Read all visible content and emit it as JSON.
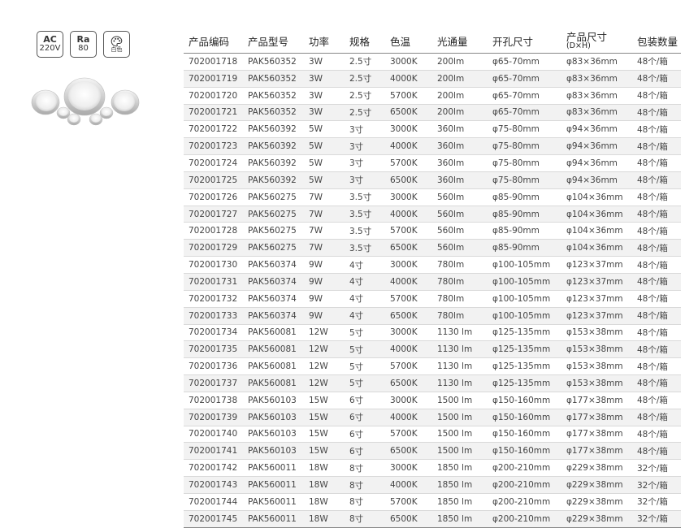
{
  "badges": [
    {
      "top": "AC",
      "bottom": "220V"
    },
    {
      "top": "Ra",
      "bottom": "80"
    },
    {
      "top_icon": "palette-icon",
      "bottom": "白色"
    }
  ],
  "table": {
    "headers": [
      "产品编码",
      "产品型号",
      "功率",
      "规格",
      "色温",
      "光通量",
      "开孔尺寸",
      "产品尺寸",
      "包装数量"
    ],
    "header_sub": "(D×H)",
    "rows": [
      [
        "702001718",
        "PAK560352",
        "3W",
        "2.5寸",
        "3000K",
        "200lm",
        "φ65-70mm",
        "φ83×36mm",
        "48个/箱"
      ],
      [
        "702001719",
        "PAK560352",
        "3W",
        "2.5寸",
        "4000K",
        "200lm",
        "φ65-70mm",
        "φ83×36mm",
        "48个/箱"
      ],
      [
        "702001720",
        "PAK560352",
        "3W",
        "2.5寸",
        "5700K",
        "200lm",
        "φ65-70mm",
        "φ83×36mm",
        "48个/箱"
      ],
      [
        "702001721",
        "PAK560352",
        "3W",
        "2.5寸",
        "6500K",
        "200lm",
        "φ65-70mm",
        "φ83×36mm",
        "48个/箱"
      ],
      [
        "702001722",
        "PAK560392",
        "5W",
        "3寸",
        "3000K",
        "360lm",
        "φ75-80mm",
        "φ94×36mm",
        "48个/箱"
      ],
      [
        "702001723",
        "PAK560392",
        "5W",
        "3寸",
        "4000K",
        "360lm",
        "φ75-80mm",
        "φ94×36mm",
        "48个/箱"
      ],
      [
        "702001724",
        "PAK560392",
        "5W",
        "3寸",
        "5700K",
        "360lm",
        "φ75-80mm",
        "φ94×36mm",
        "48个/箱"
      ],
      [
        "702001725",
        "PAK560392",
        "5W",
        "3寸",
        "6500K",
        "360lm",
        "φ75-80mm",
        "φ94×36mm",
        "48个/箱"
      ],
      [
        "702001726",
        "PAK560275",
        "7W",
        "3.5寸",
        "3000K",
        "560lm",
        "φ85-90mm",
        "φ104×36mm",
        "48个/箱"
      ],
      [
        "702001727",
        "PAK560275",
        "7W",
        "3.5寸",
        "4000K",
        "560lm",
        "φ85-90mm",
        "φ104×36mm",
        "48个/箱"
      ],
      [
        "702001728",
        "PAK560275",
        "7W",
        "3.5寸",
        "5700K",
        "560lm",
        "φ85-90mm",
        "φ104×36mm",
        "48个/箱"
      ],
      [
        "702001729",
        "PAK560275",
        "7W",
        "3.5寸",
        "6500K",
        "560lm",
        "φ85-90mm",
        "φ104×36mm",
        "48个/箱"
      ],
      [
        "702001730",
        "PAK560374",
        "9W",
        "4寸",
        "3000K",
        "780lm",
        "φ100-105mm",
        "φ123×37mm",
        "48个/箱"
      ],
      [
        "702001731",
        "PAK560374",
        "9W",
        "4寸",
        "4000K",
        "780lm",
        "φ100-105mm",
        "φ123×37mm",
        "48个/箱"
      ],
      [
        "702001732",
        "PAK560374",
        "9W",
        "4寸",
        "5700K",
        "780lm",
        "φ100-105mm",
        "φ123×37mm",
        "48个/箱"
      ],
      [
        "702001733",
        "PAK560374",
        "9W",
        "4寸",
        "6500K",
        "780lm",
        "φ100-105mm",
        "φ123×37mm",
        "48个/箱"
      ],
      [
        "702001734",
        "PAK560081",
        "12W",
        "5寸",
        "3000K",
        "1130 lm",
        "φ125-135mm",
        "φ153×38mm",
        "48个/箱"
      ],
      [
        "702001735",
        "PAK560081",
        "12W",
        "5寸",
        "4000K",
        "1130 lm",
        "φ125-135mm",
        "φ153×38mm",
        "48个/箱"
      ],
      [
        "702001736",
        "PAK560081",
        "12W",
        "5寸",
        "5700K",
        "1130 lm",
        "φ125-135mm",
        "φ153×38mm",
        "48个/箱"
      ],
      [
        "702001737",
        "PAK560081",
        "12W",
        "5寸",
        "6500K",
        "1130 lm",
        "φ125-135mm",
        "φ153×38mm",
        "48个/箱"
      ],
      [
        "702001738",
        "PAK560103",
        "15W",
        "6寸",
        "3000K",
        "1500 lm",
        "φ150-160mm",
        "φ177×38mm",
        "48个/箱"
      ],
      [
        "702001739",
        "PAK560103",
        "15W",
        "6寸",
        "4000K",
        "1500 lm",
        "φ150-160mm",
        "φ177×38mm",
        "48个/箱"
      ],
      [
        "702001740",
        "PAK560103",
        "15W",
        "6寸",
        "5700K",
        "1500 lm",
        "φ150-160mm",
        "φ177×38mm",
        "48个/箱"
      ],
      [
        "702001741",
        "PAK560103",
        "15W",
        "6寸",
        "6500K",
        "1500 lm",
        "φ150-160mm",
        "φ177×38mm",
        "48个/箱"
      ],
      [
        "702001742",
        "PAK560011",
        "18W",
        "8寸",
        "3000K",
        "1850 lm",
        "φ200-210mm",
        "φ229×38mm",
        "32个/箱"
      ],
      [
        "702001743",
        "PAK560011",
        "18W",
        "8寸",
        "4000K",
        "1850 lm",
        "φ200-210mm",
        "φ229×38mm",
        "32个/箱"
      ],
      [
        "702001744",
        "PAK560011",
        "18W",
        "8寸",
        "5700K",
        "1850 lm",
        "φ200-210mm",
        "φ229×38mm",
        "32个/箱"
      ],
      [
        "702001745",
        "PAK560011",
        "18W",
        "8寸",
        "6500K",
        "1850 lm",
        "φ200-210mm",
        "φ229×38mm",
        "32个/箱"
      ]
    ]
  }
}
